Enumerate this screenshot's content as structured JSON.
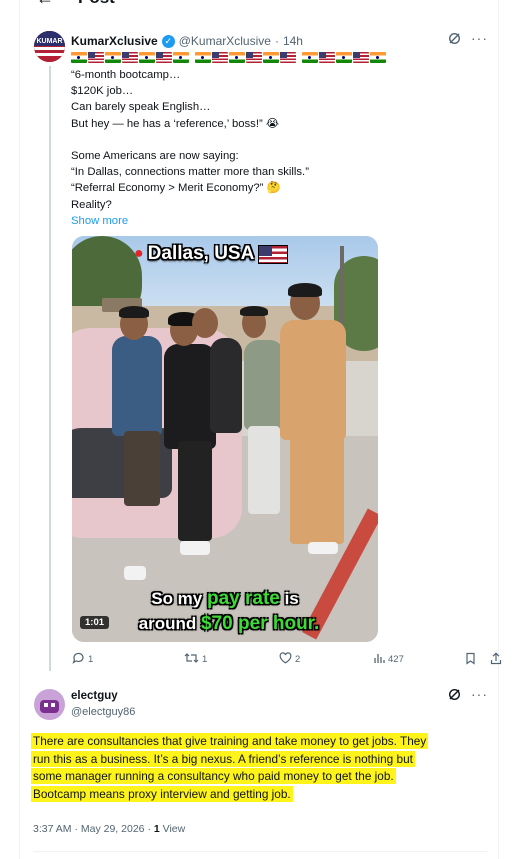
{
  "header": {
    "back_icon": "back-arrow-icon",
    "title": "Post"
  },
  "tweet": {
    "name": "KumarXclusive",
    "handle": "@KumarXclusive",
    "time": "14h",
    "separator": "·",
    "avatar_text": "KUMAR",
    "flags": [
      "in",
      "us",
      "in",
      "us",
      "in",
      "us",
      "in",
      "gap",
      "in",
      "us",
      "in",
      "us",
      "in",
      "us",
      "gap",
      "in",
      "us",
      "in",
      "us",
      "in"
    ],
    "lines": [
      "“6-month bootcamp…",
      "$120K job…",
      "Can barely speak English…",
      "But hey — he has a ‘reference,’ boss!” 😭",
      "",
      "Some Americans are now saying:",
      "“In Dallas, connections matter more than skills.”",
      "“Referral Economy > Merit Economy?” 🤔",
      "Reality?"
    ],
    "show_more": "Show more",
    "video": {
      "location_caption": "Dallas, USA",
      "subtitle_line1_pre": "So my ",
      "subtitle_line1_hl": "pay rate",
      "subtitle_line1_post": " is",
      "subtitle_line2_pre": "around ",
      "subtitle_line2_hl": "$70 per hour.",
      "duration": "1:01"
    },
    "actions": {
      "replies": "1",
      "reposts": "1",
      "likes": "2",
      "views": "427"
    }
  },
  "reply": {
    "name": "electguy",
    "handle": "@electguy86",
    "lines": [
      "There are consultancies that give training and take money to get jobs. They",
      "run this as a business. It’s a big nexus. A friend’s reference is nothing but",
      "some manager running a consultancy who paid money to get the job.",
      "Bootcamp means proxy interview and getting job."
    ],
    "time": "3:37 AM",
    "date": "May 29, 2026",
    "views_count": "1",
    "views_label": "View"
  },
  "colors": {
    "accent": "#1d9bf0",
    "highlight": "#fff41a",
    "muted": "#536471",
    "subtitle_green": "#3edb37"
  }
}
